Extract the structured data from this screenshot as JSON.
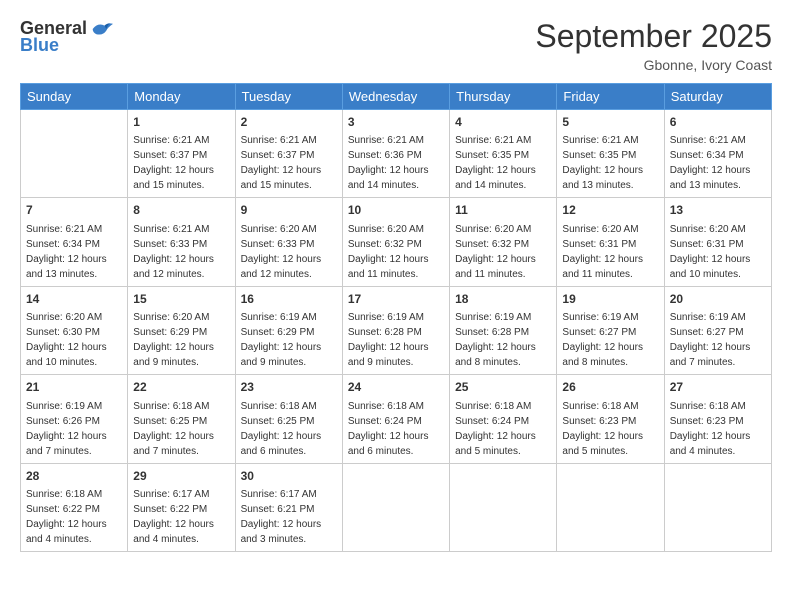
{
  "logo": {
    "general": "General",
    "blue": "Blue"
  },
  "title": "September 2025",
  "location": "Gbonne, Ivory Coast",
  "days_header": [
    "Sunday",
    "Monday",
    "Tuesday",
    "Wednesday",
    "Thursday",
    "Friday",
    "Saturday"
  ],
  "weeks": [
    [
      {
        "day": "",
        "info": ""
      },
      {
        "day": "1",
        "info": "Sunrise: 6:21 AM\nSunset: 6:37 PM\nDaylight: 12 hours\nand 15 minutes."
      },
      {
        "day": "2",
        "info": "Sunrise: 6:21 AM\nSunset: 6:37 PM\nDaylight: 12 hours\nand 15 minutes."
      },
      {
        "day": "3",
        "info": "Sunrise: 6:21 AM\nSunset: 6:36 PM\nDaylight: 12 hours\nand 14 minutes."
      },
      {
        "day": "4",
        "info": "Sunrise: 6:21 AM\nSunset: 6:35 PM\nDaylight: 12 hours\nand 14 minutes."
      },
      {
        "day": "5",
        "info": "Sunrise: 6:21 AM\nSunset: 6:35 PM\nDaylight: 12 hours\nand 13 minutes."
      },
      {
        "day": "6",
        "info": "Sunrise: 6:21 AM\nSunset: 6:34 PM\nDaylight: 12 hours\nand 13 minutes."
      }
    ],
    [
      {
        "day": "7",
        "info": "Sunrise: 6:21 AM\nSunset: 6:34 PM\nDaylight: 12 hours\nand 13 minutes."
      },
      {
        "day": "8",
        "info": "Sunrise: 6:21 AM\nSunset: 6:33 PM\nDaylight: 12 hours\nand 12 minutes."
      },
      {
        "day": "9",
        "info": "Sunrise: 6:20 AM\nSunset: 6:33 PM\nDaylight: 12 hours\nand 12 minutes."
      },
      {
        "day": "10",
        "info": "Sunrise: 6:20 AM\nSunset: 6:32 PM\nDaylight: 12 hours\nand 11 minutes."
      },
      {
        "day": "11",
        "info": "Sunrise: 6:20 AM\nSunset: 6:32 PM\nDaylight: 12 hours\nand 11 minutes."
      },
      {
        "day": "12",
        "info": "Sunrise: 6:20 AM\nSunset: 6:31 PM\nDaylight: 12 hours\nand 11 minutes."
      },
      {
        "day": "13",
        "info": "Sunrise: 6:20 AM\nSunset: 6:31 PM\nDaylight: 12 hours\nand 10 minutes."
      }
    ],
    [
      {
        "day": "14",
        "info": "Sunrise: 6:20 AM\nSunset: 6:30 PM\nDaylight: 12 hours\nand 10 minutes."
      },
      {
        "day": "15",
        "info": "Sunrise: 6:20 AM\nSunset: 6:29 PM\nDaylight: 12 hours\nand 9 minutes."
      },
      {
        "day": "16",
        "info": "Sunrise: 6:19 AM\nSunset: 6:29 PM\nDaylight: 12 hours\nand 9 minutes."
      },
      {
        "day": "17",
        "info": "Sunrise: 6:19 AM\nSunset: 6:28 PM\nDaylight: 12 hours\nand 9 minutes."
      },
      {
        "day": "18",
        "info": "Sunrise: 6:19 AM\nSunset: 6:28 PM\nDaylight: 12 hours\nand 8 minutes."
      },
      {
        "day": "19",
        "info": "Sunrise: 6:19 AM\nSunset: 6:27 PM\nDaylight: 12 hours\nand 8 minutes."
      },
      {
        "day": "20",
        "info": "Sunrise: 6:19 AM\nSunset: 6:27 PM\nDaylight: 12 hours\nand 7 minutes."
      }
    ],
    [
      {
        "day": "21",
        "info": "Sunrise: 6:19 AM\nSunset: 6:26 PM\nDaylight: 12 hours\nand 7 minutes."
      },
      {
        "day": "22",
        "info": "Sunrise: 6:18 AM\nSunset: 6:25 PM\nDaylight: 12 hours\nand 7 minutes."
      },
      {
        "day": "23",
        "info": "Sunrise: 6:18 AM\nSunset: 6:25 PM\nDaylight: 12 hours\nand 6 minutes."
      },
      {
        "day": "24",
        "info": "Sunrise: 6:18 AM\nSunset: 6:24 PM\nDaylight: 12 hours\nand 6 minutes."
      },
      {
        "day": "25",
        "info": "Sunrise: 6:18 AM\nSunset: 6:24 PM\nDaylight: 12 hours\nand 5 minutes."
      },
      {
        "day": "26",
        "info": "Sunrise: 6:18 AM\nSunset: 6:23 PM\nDaylight: 12 hours\nand 5 minutes."
      },
      {
        "day": "27",
        "info": "Sunrise: 6:18 AM\nSunset: 6:23 PM\nDaylight: 12 hours\nand 4 minutes."
      }
    ],
    [
      {
        "day": "28",
        "info": "Sunrise: 6:18 AM\nSunset: 6:22 PM\nDaylight: 12 hours\nand 4 minutes."
      },
      {
        "day": "29",
        "info": "Sunrise: 6:17 AM\nSunset: 6:22 PM\nDaylight: 12 hours\nand 4 minutes."
      },
      {
        "day": "30",
        "info": "Sunrise: 6:17 AM\nSunset: 6:21 PM\nDaylight: 12 hours\nand 3 minutes."
      },
      {
        "day": "",
        "info": ""
      },
      {
        "day": "",
        "info": ""
      },
      {
        "day": "",
        "info": ""
      },
      {
        "day": "",
        "info": ""
      }
    ]
  ]
}
